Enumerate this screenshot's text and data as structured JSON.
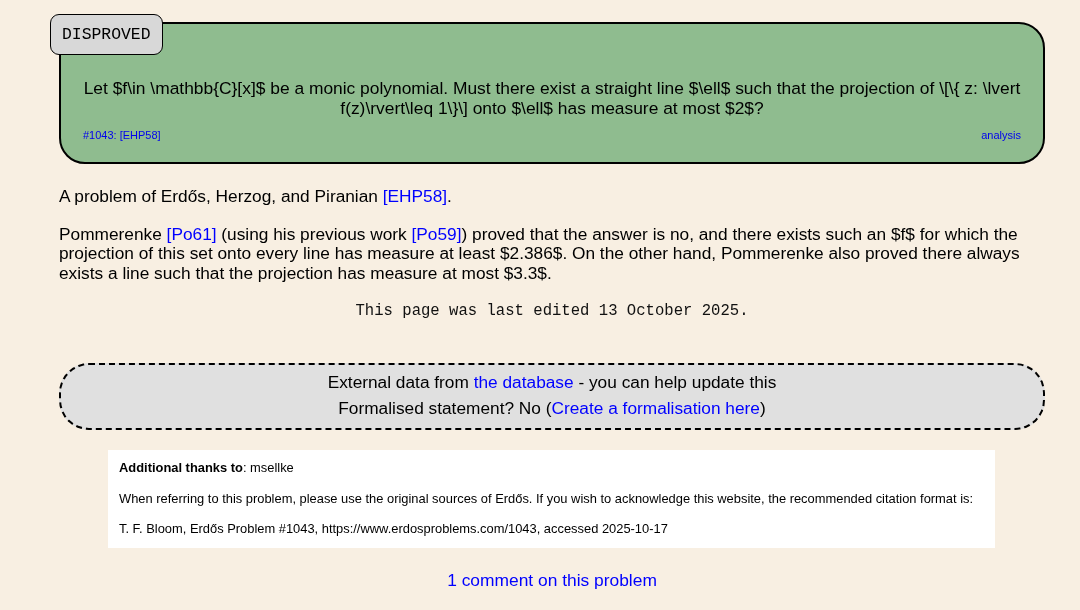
{
  "problem": {
    "status": "DISPROVED",
    "statement": "Let $f\\in \\mathbb{C}[x]$ be a monic polynomial. Must there exist a straight line $\\ell$ such that the projection of \\[\\{ z: \\lvert f(z)\\rvert\\leq 1\\}\\] onto $\\ell$ has measure at most $2$?",
    "reference": "#1043: [EHP58]",
    "tag": "analysis"
  },
  "description": [
    [
      {
        "kind": "text",
        "text": "A problem of Erdős, Herzog, and Piranian "
      },
      {
        "kind": "link",
        "text": "[EHP58]"
      },
      {
        "kind": "text",
        "text": "."
      }
    ],
    [
      {
        "kind": "text",
        "text": "Pommerenke "
      },
      {
        "kind": "link",
        "text": "[Po61]"
      },
      {
        "kind": "text",
        "text": " (using his previous work "
      },
      {
        "kind": "link",
        "text": "[Po59]"
      },
      {
        "kind": "text",
        "text": ") proved that the answer is no, and there exists such an $f$ for which the projection of this set onto every line has measure at least $2.386$. On the other hand, Pommerenke also proved there always exists a line such that the projection has measure at most $3.3$."
      }
    ]
  ],
  "last_edited": "This page was last edited 13 October 2025.",
  "external_data": [
    [
      {
        "kind": "text",
        "text": "External data from "
      },
      {
        "kind": "link",
        "text": "the database"
      },
      {
        "kind": "text",
        "text": " - you can help update this"
      }
    ],
    [
      {
        "kind": "text",
        "text": "Formalised statement? No ("
      },
      {
        "kind": "link",
        "text": "Create a formalisation here"
      },
      {
        "kind": "text",
        "text": ")"
      }
    ]
  ],
  "acknowledgements": [
    "**Additional thanks to**: msellke",
    "When referring to this problem, please use the original sources of Erdős. If you wish to acknowledge this website, the recommended citation format is:",
    "T. F. Bloom, Erdős Problem #1043, https://www.erdosproblems.com/1043, accessed 2025-10-17"
  ],
  "comments_link": "1 comment on this problem"
}
